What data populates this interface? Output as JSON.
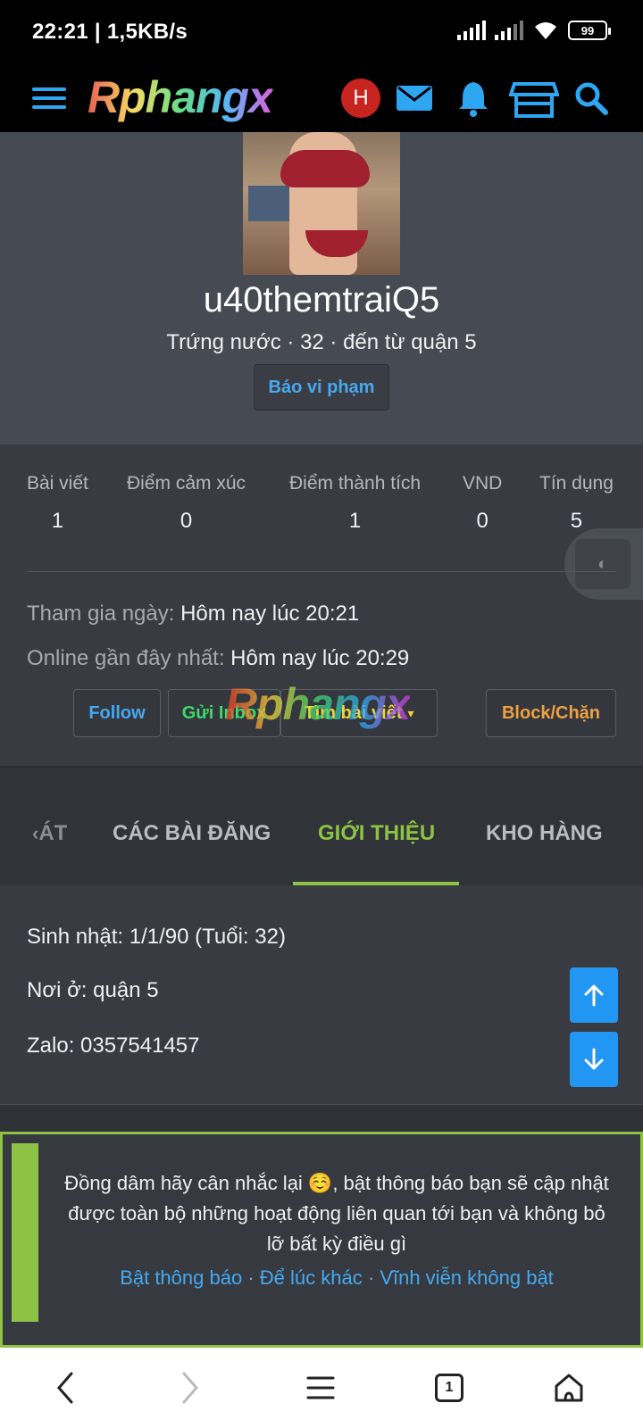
{
  "status": {
    "time": "22:21 | 1,5KB/s",
    "battery": "99"
  },
  "header": {
    "logo": "Rphangx",
    "avatar_letter": "H",
    "icons": [
      "menu-icon",
      "mail-icon",
      "bell-icon",
      "store-icon",
      "search-icon"
    ]
  },
  "profile": {
    "username": "u40themtraiQ5",
    "meta": "Trứng nước · 32 · đến từ quận 5",
    "report_label": "Báo vi phạm"
  },
  "stats": [
    {
      "label": "Bài viết",
      "value": "1"
    },
    {
      "label": "Điểm cảm xúc",
      "value": "0"
    },
    {
      "label": "Điểm thành tích",
      "value": "1"
    },
    {
      "label": "VND",
      "value": "0"
    },
    {
      "label": "Tín dụng",
      "value": "5"
    }
  ],
  "info": {
    "joined_label": "Tham gia ngày:",
    "joined_value": "Hôm nay lúc 20:21",
    "online_label": "Online gần đây nhất:",
    "online_value": "Hôm nay lúc 20:29"
  },
  "actions": {
    "follow": "Follow",
    "inbox": "Gửi Inbox",
    "find_posts": "Tìm bài viết",
    "block": "Block/Chặn",
    "watermark": "Rphangx"
  },
  "tabs": [
    {
      "label": "ÁT"
    },
    {
      "label": "CÁC BÀI ĐĂNG"
    },
    {
      "label": "GIỚI THIỆU"
    },
    {
      "label": "KHO HÀNG"
    }
  ],
  "about": {
    "birthday": "Sinh nhật: 1/1/90 (Tuổi: 32)",
    "location": "Nơi ở: quận 5",
    "zalo": "Zalo: 0357541457"
  },
  "notice": {
    "message": "Đồng dâm hãy cân nhắc lại ☺️, bật thông báo bạn sẽ cập nhật được toàn bộ những hoạt động liên quan tới bạn và không bỏ lỡ bất kỳ điều gì",
    "enable": "Bật thông báo",
    "later": "Để lúc khác",
    "never": "Vĩnh viễn không bật",
    "sep": "·"
  },
  "bottom_nav": {
    "tab_count": "1"
  },
  "colors": {
    "accent_green": "#8dc244",
    "link_blue": "#46a8f0",
    "brand_red": "#c7241f"
  }
}
